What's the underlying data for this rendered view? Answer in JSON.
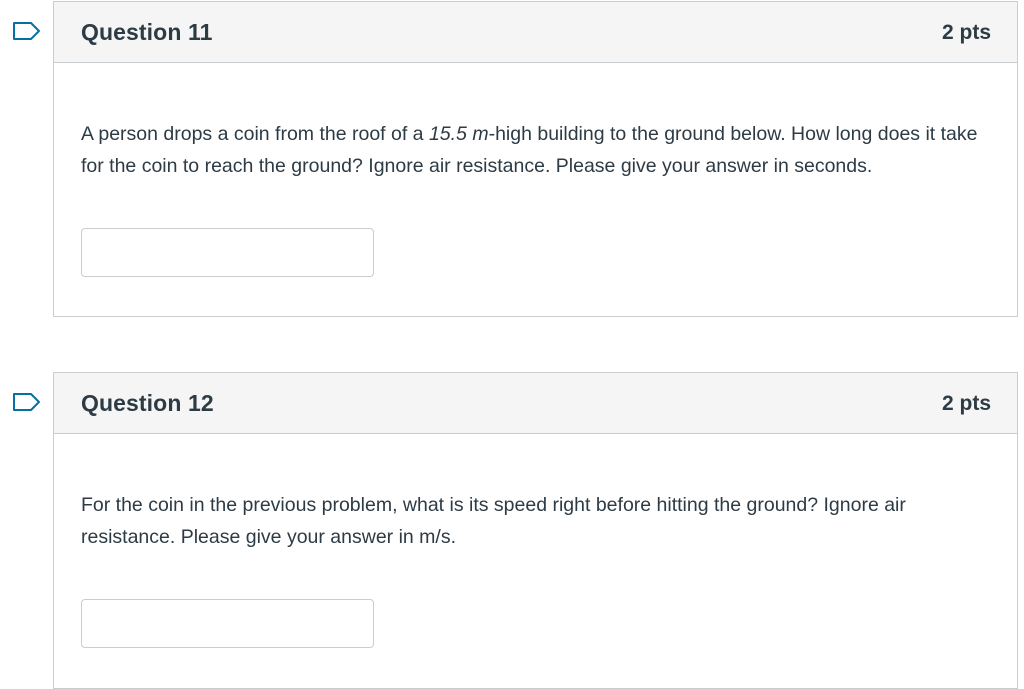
{
  "colors": {
    "flag_outline": "#0770a3",
    "border": "#c7cdd1",
    "header_bg": "#f5f5f5",
    "text": "#2d3b45"
  },
  "questions": [
    {
      "flag_icon": "flag-outline-icon",
      "title": "Question 11",
      "points": "2 pts",
      "text_before": "A person drops a coin from the roof of a ",
      "text_emphasis": "15.5 m",
      "text_after": "-high building to the ground below. How long does it take for the coin to reach the ground? Ignore air resistance. Please give your answer in seconds.",
      "answer_value": ""
    },
    {
      "flag_icon": "flag-outline-icon",
      "title": "Question 12",
      "points": "2 pts",
      "text": "For the coin in the previous problem, what is its speed right before hitting the ground? Ignore air resistance. Please give your answer in m/s.",
      "answer_value": ""
    }
  ]
}
